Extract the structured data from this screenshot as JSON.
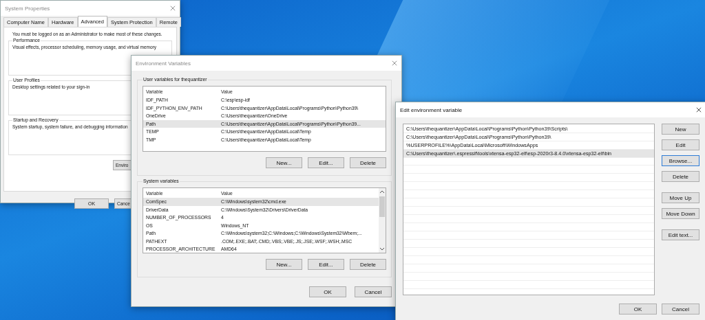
{
  "system_properties": {
    "title": "System Properties",
    "tabs": [
      {
        "label": "Computer Name",
        "selected": false
      },
      {
        "label": "Hardware",
        "selected": false
      },
      {
        "label": "Advanced",
        "selected": true
      },
      {
        "label": "System Protection",
        "selected": false
      },
      {
        "label": "Remote",
        "selected": false
      }
    ],
    "notice": "You must be logged on as an Administrator to make most of these changes.",
    "groups": [
      {
        "title": "Performance",
        "text": "Visual effects, processor scheduling, memory usage, and virtual memory"
      },
      {
        "title": "User Profiles",
        "text": "Desktop settings related to your sign-in"
      },
      {
        "title": "Startup and Recovery",
        "text": "System startup, system failure, and debugging information"
      }
    ],
    "env_button": "Enviro",
    "buttons": [
      "OK",
      "Cance"
    ]
  },
  "environment_variables": {
    "title": "Environment Variables",
    "user_group": {
      "title": "User variables for thequantizer",
      "columns": [
        "Variable",
        "Value"
      ],
      "rows": [
        {
          "variable": "IDF_PATH",
          "value": "C:\\esp\\esp-idf",
          "selected": false
        },
        {
          "variable": "IDF_PYTHON_ENV_PATH",
          "value": "C:\\Users\\thequantizer\\AppData\\Local\\Programs\\Python\\Python39\\",
          "selected": false
        },
        {
          "variable": "OneDrive",
          "value": "C:\\Users\\thequantizer\\OneDrive",
          "selected": false
        },
        {
          "variable": "Path",
          "value": "C:\\Users\\thequantizer\\AppData\\Local\\Programs\\Python\\Python39...",
          "selected": true
        },
        {
          "variable": "TEMP",
          "value": "C:\\Users\\thequantizer\\AppData\\Local\\Temp",
          "selected": false
        },
        {
          "variable": "TMP",
          "value": "C:\\Users\\thequantizer\\AppData\\Local\\Temp",
          "selected": false
        }
      ],
      "buttons": [
        "New...",
        "Edit...",
        "Delete"
      ]
    },
    "system_group": {
      "title": "System variables",
      "columns": [
        "Variable",
        "Value"
      ],
      "rows": [
        {
          "variable": "ComSpec",
          "value": "C:\\Windows\\system32\\cmd.exe",
          "selected": true
        },
        {
          "variable": "DriverData",
          "value": "C:\\Windows\\System32\\Drivers\\DriverData",
          "selected": false
        },
        {
          "variable": "NUMBER_OF_PROCESSORS",
          "value": "4",
          "selected": false
        },
        {
          "variable": "OS",
          "value": "Windows_NT",
          "selected": false
        },
        {
          "variable": "Path",
          "value": "C:\\Windows\\system32;C:\\Windows;C:\\Windows\\System32\\Wbem;...",
          "selected": false
        },
        {
          "variable": "PATHEXT",
          "value": ".COM;.EXE;.BAT;.CMD;.VBS;.VBE;.JS;.JSE;.WSF;.WSH;.MSC",
          "selected": false
        },
        {
          "variable": "PROCESSOR_ARCHITECTURE",
          "value": "AMD64",
          "selected": false
        }
      ],
      "buttons": [
        "New...",
        "Edit...",
        "Delete"
      ]
    },
    "buttons": [
      "OK",
      "Cancel"
    ]
  },
  "edit_variable": {
    "title": "Edit environment variable",
    "entries": [
      {
        "text": "C:\\Users\\thequantizer\\AppData\\Local\\Programs\\Python\\Python39\\Scripts\\",
        "selected": false
      },
      {
        "text": "C:\\Users\\thequantizer\\AppData\\Local\\Programs\\Python\\Python39\\",
        "selected": false
      },
      {
        "text": "%USERPROFILE%\\AppData\\Local\\Microsoft\\WindowsApps",
        "selected": false
      },
      {
        "text": "C:\\Users\\thequantizer\\.espressif\\tools\\xtensa-esp32-elf\\esp-2020r3-8.4.0\\xtensa-esp32-elf\\bin",
        "selected": true
      }
    ],
    "button_groups": [
      [
        {
          "label": "New",
          "focused": false
        },
        {
          "label": "Edit",
          "focused": false
        },
        {
          "label": "Browse...",
          "focused": true
        },
        {
          "label": "Delete",
          "focused": false
        }
      ],
      [
        {
          "label": "Move Up",
          "focused": false
        },
        {
          "label": "Move Down",
          "focused": false
        }
      ],
      [
        {
          "label": "Edit text...",
          "focused": false
        }
      ]
    ],
    "buttons": [
      "OK",
      "Cancel"
    ]
  }
}
